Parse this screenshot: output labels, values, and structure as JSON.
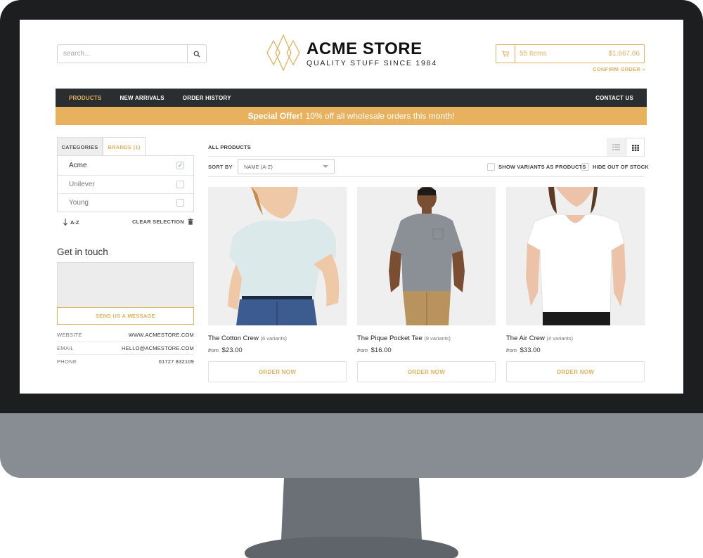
{
  "header": {
    "search_placeholder": "search...",
    "logo_title": "ACME STORE",
    "logo_subtitle": "QUALITY STUFF SINCE 1984",
    "cart_items": "55 Items",
    "cart_total": "$1,667.66",
    "confirm_order": "CONFIRM ORDER »"
  },
  "nav": {
    "items": [
      "PRODUCTS",
      "NEW ARRIVALS",
      "ORDER HISTORY"
    ],
    "contact": "CONTACT US",
    "offer_bold": "Special Offer!",
    "offer_text": "10% off all wholesale orders this month!"
  },
  "sidebar": {
    "tabs": [
      "CATEGORIES",
      "BRANDS (1)"
    ],
    "brands": [
      {
        "label": "Acme",
        "checked": true
      },
      {
        "label": "Unilever",
        "checked": false
      },
      {
        "label": "Young",
        "checked": false
      }
    ],
    "sort_az": "A-Z",
    "clear_selection": "CLEAR SELECTION",
    "get_in_touch": "Get in touch",
    "send_message": "SEND US A MESSAGE",
    "contact": [
      {
        "label": "WEBSITE",
        "value": "WWW.ACMESTORE.COM"
      },
      {
        "label": "EMAIL",
        "value": "HELLO@ACMESTORE.COM"
      },
      {
        "label": "PHONE",
        "value": "01727 832109"
      }
    ]
  },
  "products": {
    "heading": "ALL PRODUCTS",
    "sort_by": "SORT BY",
    "sort_value": "NAME (A-Z)",
    "show_variants": "SHOW VARIANTS AS PRODUCTS",
    "hide_out_of_stock": "HIDE OUT OF STOCK",
    "items": [
      {
        "name": "The Cotton Crew",
        "variants": "(6 variants)",
        "from": "from",
        "price": "$23.00",
        "button": "ORDER NOW"
      },
      {
        "name": "The Pique Pocket Tee",
        "variants": "(8 variants)",
        "from": "from",
        "price": "$16.00",
        "button": "ORDER NOW"
      },
      {
        "name": "The Air Crew",
        "variants": "(4 variants)",
        "from": "from",
        "price": "$33.00",
        "button": "ORDER NOW"
      }
    ]
  },
  "colors": {
    "accent": "#e3b15e",
    "nav_bg": "#2b2e31",
    "offer_bg": "#e8b15e"
  }
}
